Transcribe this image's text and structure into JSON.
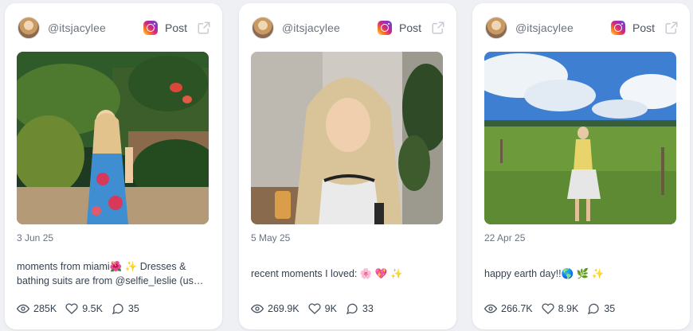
{
  "post_label": "Post",
  "posts": [
    {
      "handle": "@itsjacylee",
      "date": "3 Jun 25",
      "caption_line1": "moments from miami🌺 ✨ Dresses &",
      "caption_line2": "bathing suits are from @selfie_leslie (us…",
      "views": "285K",
      "likes": "9.5K",
      "comments": "35"
    },
    {
      "handle": "@itsjacylee",
      "date": "5 May 25",
      "caption_line1": "recent moments I loved: 🌸 💖 ✨",
      "caption_line2": "",
      "views": "269.9K",
      "likes": "9K",
      "comments": "33"
    },
    {
      "handle": "@itsjacylee",
      "date": "22 Apr 25",
      "caption_line1": "happy earth day!!🌎 🌿 ✨",
      "caption_line2": "",
      "views": "266.7K",
      "likes": "8.9K",
      "comments": "35"
    }
  ],
  "icons": {
    "platform": "instagram-icon",
    "external": "external-link-icon",
    "views": "eye-icon",
    "likes": "heart-icon",
    "comments": "comment-icon"
  },
  "colors": {
    "page_bg": "#eef0f4",
    "card_bg": "#ffffff",
    "muted_text": "#6b7280",
    "body_text": "#374151"
  }
}
